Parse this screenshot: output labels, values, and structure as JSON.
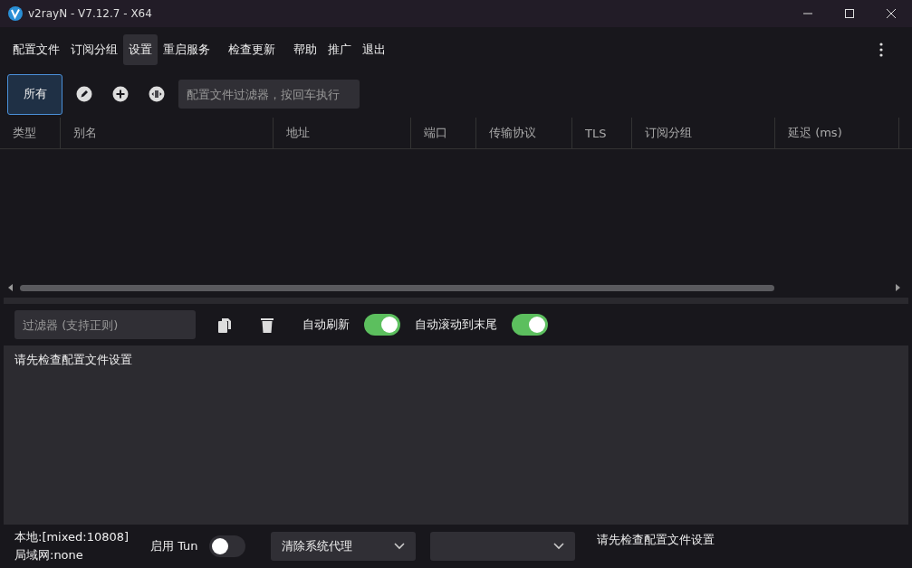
{
  "window": {
    "title": "v2rayN - V7.12.7 - X64"
  },
  "menu": [
    {
      "label": "配置文件",
      "selected": false
    },
    {
      "label": "订阅分组",
      "selected": false
    },
    {
      "label": "设置",
      "selected": true
    },
    {
      "label": "重启服务",
      "selected": false
    },
    {
      "label": "检查更新",
      "selected": false
    },
    {
      "label": "帮助",
      "selected": false
    },
    {
      "label": "推广",
      "selected": false
    },
    {
      "label": "退出",
      "selected": false
    }
  ],
  "groups": [
    {
      "label": "所有",
      "selected": true
    }
  ],
  "filter": {
    "placeholder": "配置文件过滤器，按回车执行"
  },
  "table": {
    "columns": [
      "类型",
      "别名",
      "地址",
      "端口",
      "传输协议",
      "TLS",
      "订阅分组",
      "延迟 (ms)"
    ]
  },
  "log": {
    "filter_placeholder": "过滤器 (支持正则)",
    "toggles": [
      {
        "label": "自动刷新",
        "on": true
      },
      {
        "label": "自动滚动到末尾",
        "on": true
      }
    ],
    "text": "请先检查配置文件设置"
  },
  "status": {
    "local": "本地:[mixed:10808]",
    "lan": "局域网:none",
    "tun": {
      "label": "启用 Tun",
      "on": false
    },
    "proxy_select": "清除系统代理",
    "message": "请先检查配置文件设置"
  }
}
